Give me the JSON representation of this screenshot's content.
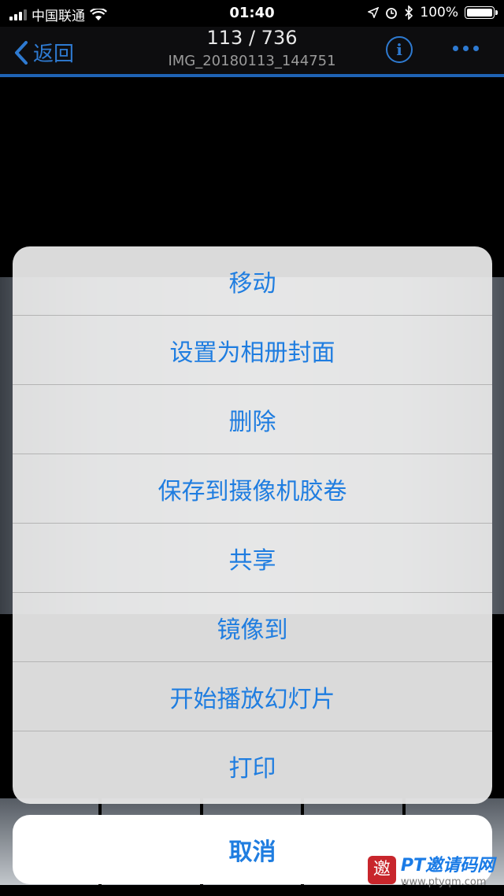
{
  "status_bar": {
    "carrier": "中国联通",
    "time": "01:40",
    "battery": "100%",
    "battery_level": 1.0,
    "icons": [
      "signal-icon",
      "wifi-icon",
      "location-icon",
      "alarm-icon",
      "bluetooth-icon",
      "battery-icon"
    ]
  },
  "nav": {
    "back_label": "返回",
    "title": "113 / 736",
    "subtitle": "IMG_20180113_144751",
    "accent_color": "#2e7ad1"
  },
  "action_sheet": {
    "items": [
      "移动",
      "设置为相册封面",
      "删除",
      "保存到摄像机胶卷",
      "共享",
      "镜像到",
      "开始播放幻灯片",
      "打印"
    ],
    "cancel_label": "取消",
    "text_color": "#1f7de0"
  },
  "watermark": {
    "seal": "邀",
    "text": "PT邀请码网",
    "url": "www.ptyqm.com"
  }
}
